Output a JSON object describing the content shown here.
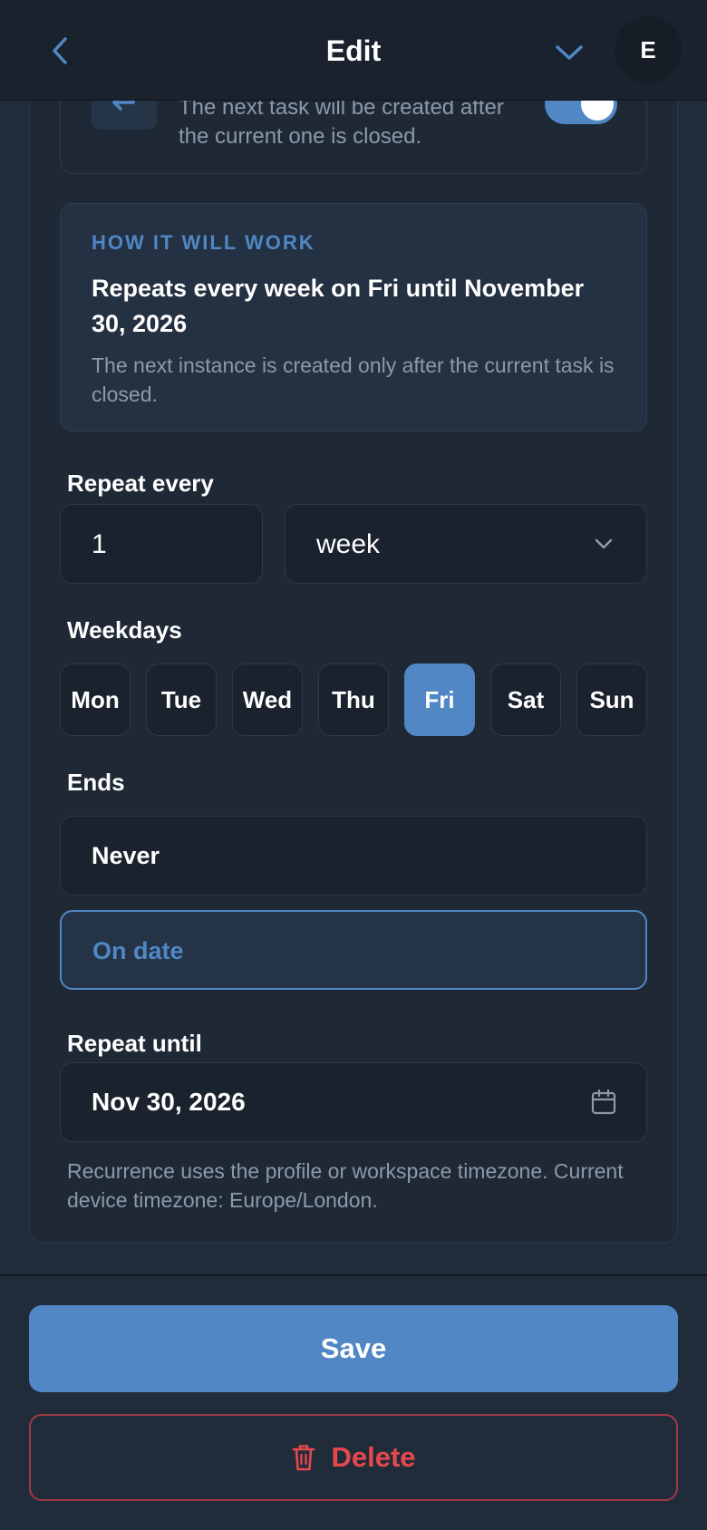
{
  "header": {
    "title": "Edit",
    "avatar_initial": "E"
  },
  "repeat_option": {
    "description": "The next task will be created after the current one is closed.",
    "toggle_on": true
  },
  "summary": {
    "heading": "HOW IT WILL WORK",
    "text": "Repeats every week on Fri until November 30, 2026",
    "note": "The next instance is created only after the current task is closed."
  },
  "repeat_every": {
    "label": "Repeat every",
    "interval": "1",
    "unit": "week"
  },
  "weekdays": {
    "label": "Weekdays",
    "days": [
      "Mon",
      "Tue",
      "Wed",
      "Thu",
      "Fri",
      "Sat",
      "Sun"
    ],
    "selected": "Fri"
  },
  "ends": {
    "label": "Ends",
    "options": [
      "Never",
      "On date"
    ],
    "selected": "On date"
  },
  "repeat_until": {
    "label": "Repeat until",
    "value": "Nov 30, 2026"
  },
  "timezone_note": "Recurrence uses the profile or workspace timezone. Current device timezone: Europe/London.",
  "footer": {
    "save_label": "Save",
    "delete_label": "Delete"
  },
  "colors": {
    "accent": "#5187c4",
    "danger": "#e5484d",
    "background": "#212c3b"
  }
}
